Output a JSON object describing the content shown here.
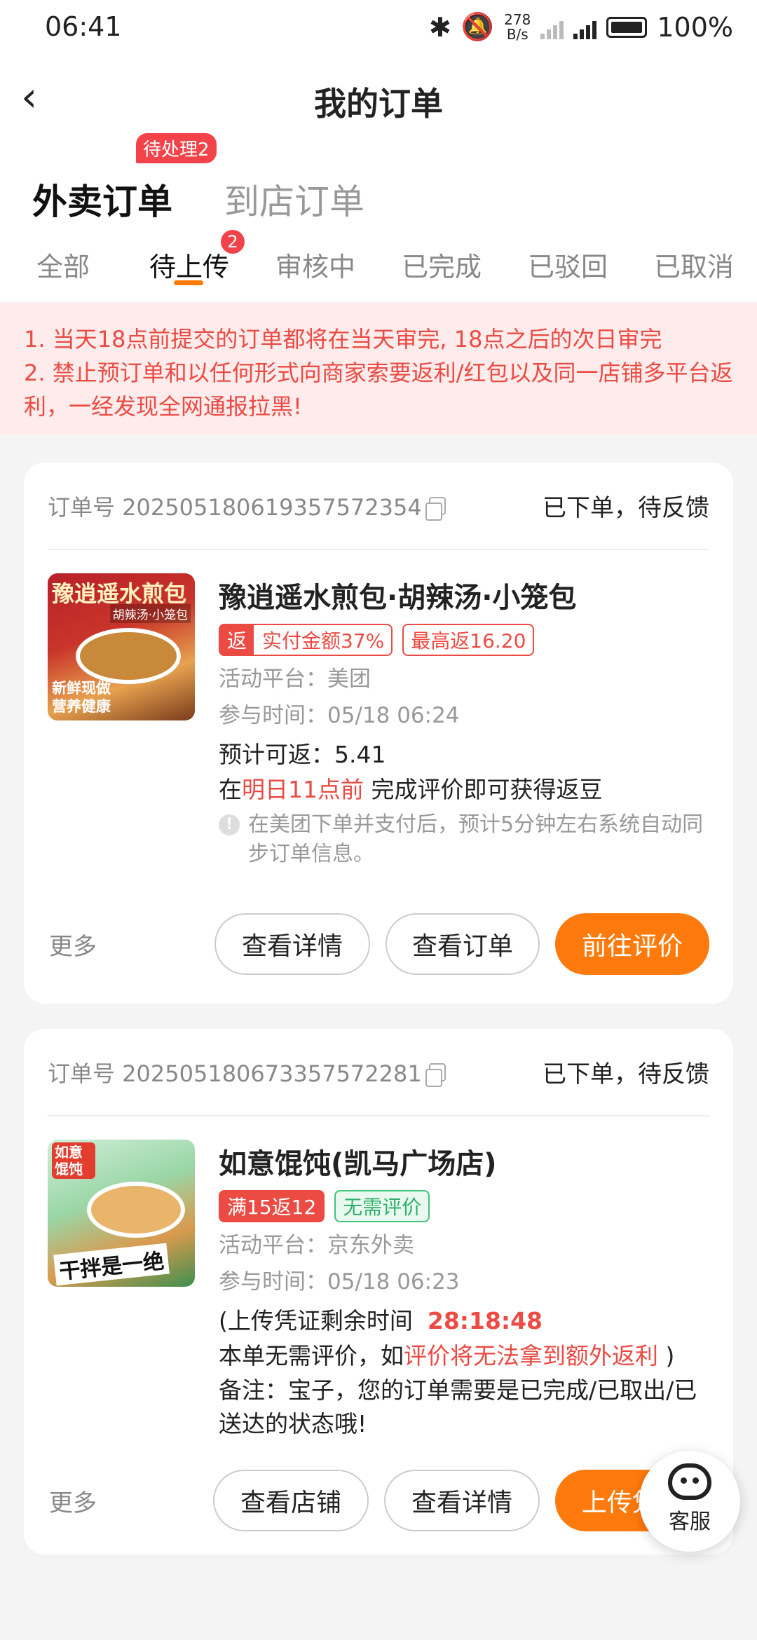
{
  "status_bar": {
    "time": "06:41",
    "net_speed_top": "278",
    "net_speed_bottom": "B/s",
    "battery": "100%"
  },
  "nav": {
    "title": "我的订单"
  },
  "main_tabs": [
    {
      "label": "外卖订单"
    },
    {
      "label": "到店订单"
    }
  ],
  "pending_badge": "待处理2",
  "sub_tabs": [
    {
      "label": "全部"
    },
    {
      "label": "待上传"
    },
    {
      "label": "审核中"
    },
    {
      "label": "已完成"
    },
    {
      "label": "已驳回"
    },
    {
      "label": "已取消"
    }
  ],
  "sub_tab_badge": "2",
  "notice": {
    "line1": "1. 当天18点前提交的订单都将在当天审完, 18点之后的次日审完",
    "line2": "2. 禁止预订单和以任何形式向商家索要返利/红包以及同一店铺多平台返利，一经发现全网通报拉黑!"
  },
  "orders": [
    {
      "order_no": "订单号 202505180619357572354",
      "status": "已下单，待反馈",
      "thumb_text_top": "豫逍遥水煎包",
      "thumb_text_sub": "胡辣汤·小笼包",
      "thumb_text_bottom": "新鲜现做",
      "thumb_text_bottom2": "营养健康",
      "name": "豫逍遥水煎包·胡辣汤·小笼包",
      "tag1_prefix": "返",
      "tag1": "实付金额37%",
      "tag2": "最高返16.20",
      "platform": "活动平台：美团",
      "time": "参与时间：05/18 06:24",
      "estimate": "预计可返：5.41",
      "review_pre": "在",
      "review_deadline": "明日11点前",
      "review_post": " 完成评价即可获得返豆",
      "hint": "在美团下单并支付后，预计5分钟左右系统自动同步订单信息。",
      "more": "更多",
      "btn1": "查看详情",
      "btn2": "查看订单",
      "btn3": "前往评价"
    },
    {
      "order_no": "订单号 202505180673357572281",
      "status": "已下单，待反馈",
      "thumb_text_top": "如意馄饨",
      "thumb_text_bottom": "干拌是一绝",
      "name": "如意馄饨(凯马广场店)",
      "tag1": "满15返12",
      "tag2": "无需评价",
      "platform": "活动平台：京东外卖",
      "time": "参与时间：05/18 06:23",
      "countdown_label": "(上传凭证剩余时间",
      "countdown": "28:18:48",
      "review_pre": " 本单无需评价，如",
      "review_red": "评价将无法拿到额外返利",
      "review_post": " )",
      "remark": "备注：宝子，您的订单需要是已完成/已取出/已送达的状态哦!",
      "more": "更多",
      "btn1": "查看店铺",
      "btn2": "查看详情",
      "btn3": "上传凭证"
    }
  ],
  "service": {
    "label": "客服"
  },
  "colors": {
    "accent": "#ff7a0c",
    "red": "#ec4b43",
    "green": "#2fb06a"
  }
}
